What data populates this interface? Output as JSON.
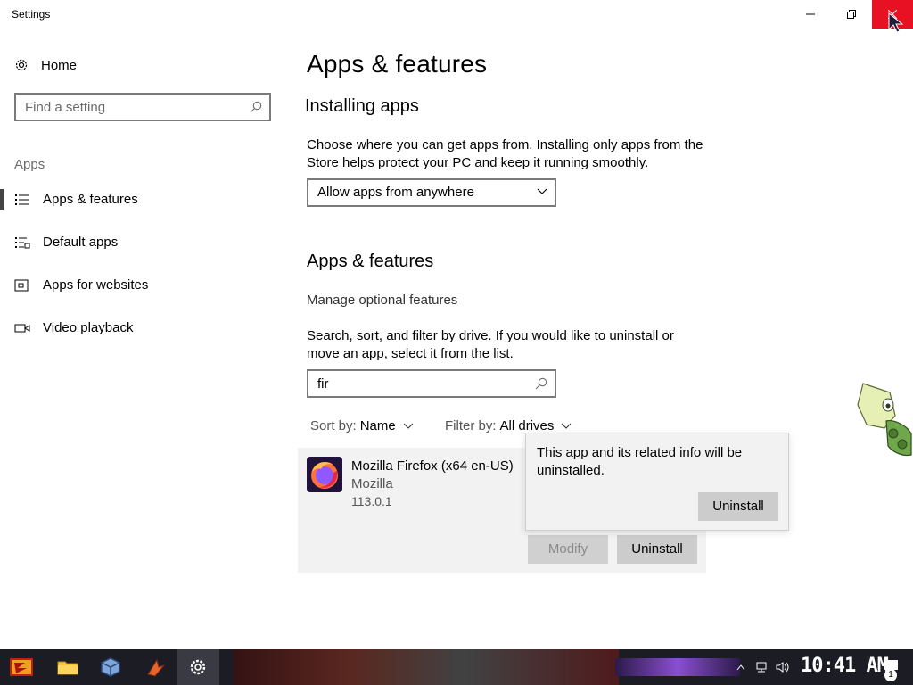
{
  "window": {
    "title": "Settings",
    "minimize_icon": "minimize-icon",
    "restore_icon": "restore-icon",
    "close_icon": "close-icon"
  },
  "sidebar": {
    "home_label": "Home",
    "search_placeholder": "Find a setting",
    "group_label": "Apps",
    "items": [
      {
        "label": "Apps & features",
        "icon": "apps-features-icon",
        "active": true
      },
      {
        "label": "Default apps",
        "icon": "default-apps-icon",
        "active": false
      },
      {
        "label": "Apps for websites",
        "icon": "apps-websites-icon",
        "active": false
      },
      {
        "label": "Video playback",
        "icon": "video-playback-icon",
        "active": false
      }
    ]
  },
  "main": {
    "title": "Apps & features",
    "installing": {
      "heading": "Installing apps",
      "description": "Choose where you can get apps from. Installing only apps from the Store helps protect your PC and keep it running smoothly.",
      "dropdown_value": "Allow apps from anywhere"
    },
    "features": {
      "heading": "Apps & features",
      "optional_link": "Manage optional features",
      "description": "Search, sort, and filter by drive. If you would like to uninstall or move an app, select it from the list.",
      "search_value": "fir",
      "sort_prefix": "Sort by:",
      "sort_value": "Name",
      "filter_prefix": "Filter by:",
      "filter_value": "All drives"
    },
    "app": {
      "name": "Mozilla Firefox (x64 en-US)",
      "publisher": "Mozilla",
      "version": "113.0.1",
      "modify_label": "Modify",
      "uninstall_label": "Uninstall"
    },
    "flyout": {
      "message": "This app and its related info will be uninstalled.",
      "uninstall_label": "Uninstall"
    }
  },
  "taskbar": {
    "clock": "10:41 AM",
    "notification_count": "1"
  },
  "colors": {
    "close_button": "#e81123",
    "app_row_bg": "#f2f2f2",
    "button_bg": "#cccccc",
    "taskbar_bg": "#1c1c24"
  }
}
